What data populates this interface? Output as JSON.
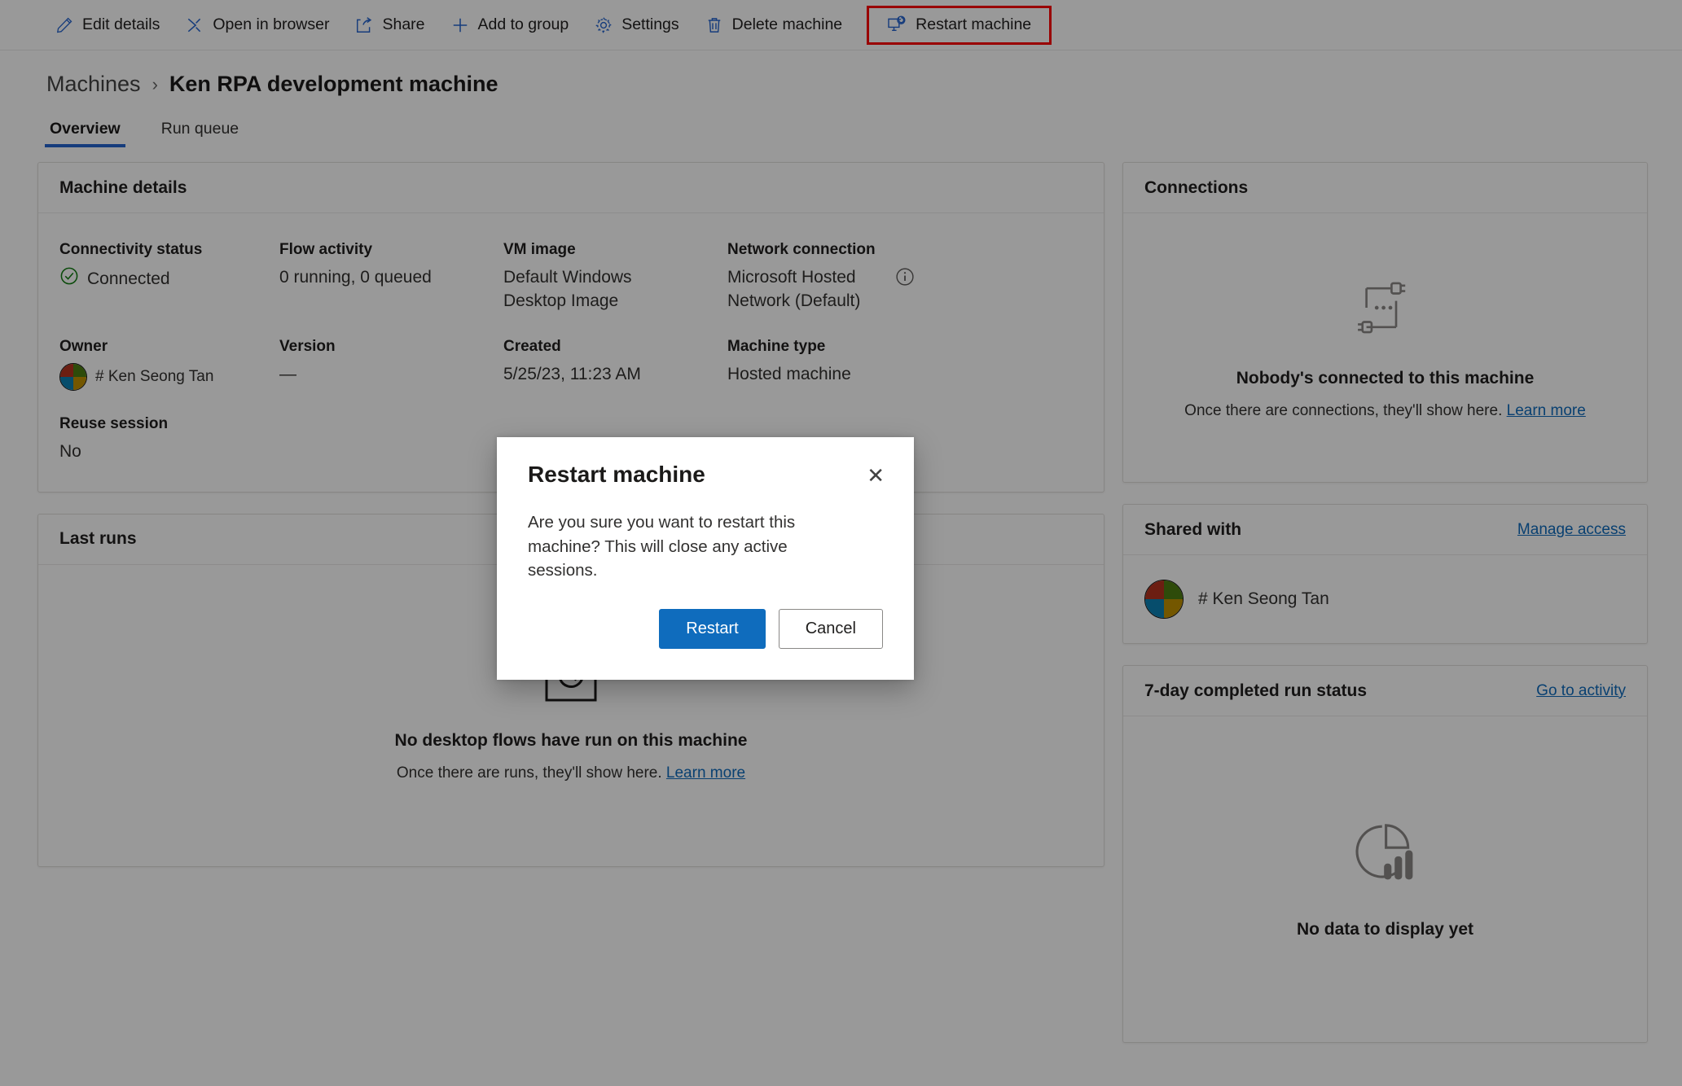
{
  "commandbar": {
    "items": [
      {
        "label": "Edit details",
        "icon": "pencil-icon"
      },
      {
        "label": "Open in browser",
        "icon": "open-in-browser-icon"
      },
      {
        "label": "Share",
        "icon": "share-icon"
      },
      {
        "label": "Add to group",
        "icon": "plus-icon"
      },
      {
        "label": "Settings",
        "icon": "gear-icon"
      },
      {
        "label": "Delete machine",
        "icon": "trash-icon"
      },
      {
        "label": "Restart machine",
        "icon": "restart-machine-icon"
      }
    ],
    "highlight_color": "#ff0000"
  },
  "breadcrumb": {
    "parent": "Machines",
    "separator": "›",
    "current": "Ken RPA development machine"
  },
  "tabs": [
    {
      "label": "Overview",
      "active": true
    },
    {
      "label": "Run queue",
      "active": false
    }
  ],
  "machine_details": {
    "title": "Machine details",
    "fields": [
      {
        "label": "Connectivity status",
        "value": "Connected",
        "icon": "check-circle-icon"
      },
      {
        "label": "Flow activity",
        "value": "0 running, 0 queued"
      },
      {
        "label": "VM image",
        "value": "Default Windows Desktop Image"
      },
      {
        "label": "Network connection",
        "value": "Microsoft Hosted Network (Default)",
        "icon": "info-icon"
      },
      {
        "label": "Owner",
        "value": "# Ken Seong Tan",
        "icon": "avatar"
      },
      {
        "label": "Version",
        "value": "—"
      },
      {
        "label": "Created",
        "value": "5/25/23, 11:23 AM"
      },
      {
        "label": "Machine type",
        "value": "Hosted machine"
      },
      {
        "label": "Reuse session",
        "value": "No"
      }
    ]
  },
  "last_runs": {
    "title": "Last runs",
    "empty_icon": "history-clock-icon",
    "empty_title": "No desktop flows have run on this machine",
    "empty_sub_prefix": "Once there are runs, they'll show here.",
    "empty_sub_link": "Learn more"
  },
  "connections": {
    "title": "Connections",
    "empty_icon": "plug-disconnected-icon",
    "empty_title": "Nobody's connected to this machine",
    "empty_sub_prefix": "Once there are connections, they'll show here.",
    "empty_sub_link": "Learn more"
  },
  "shared_with": {
    "title": "Shared with",
    "action_label": "Manage access",
    "person": "# Ken Seong Tan"
  },
  "run_status": {
    "title": "7-day completed run status",
    "action_label": "Go to activity",
    "empty_icon": "chart-pie-bar-icon",
    "empty_title": "No data to display yet"
  },
  "modal": {
    "title": "Restart machine",
    "close_label": "✕",
    "body": "Are you sure you want to restart this machine? This will close any active sessions.",
    "confirm_label": "Restart",
    "cancel_label": "Cancel"
  }
}
